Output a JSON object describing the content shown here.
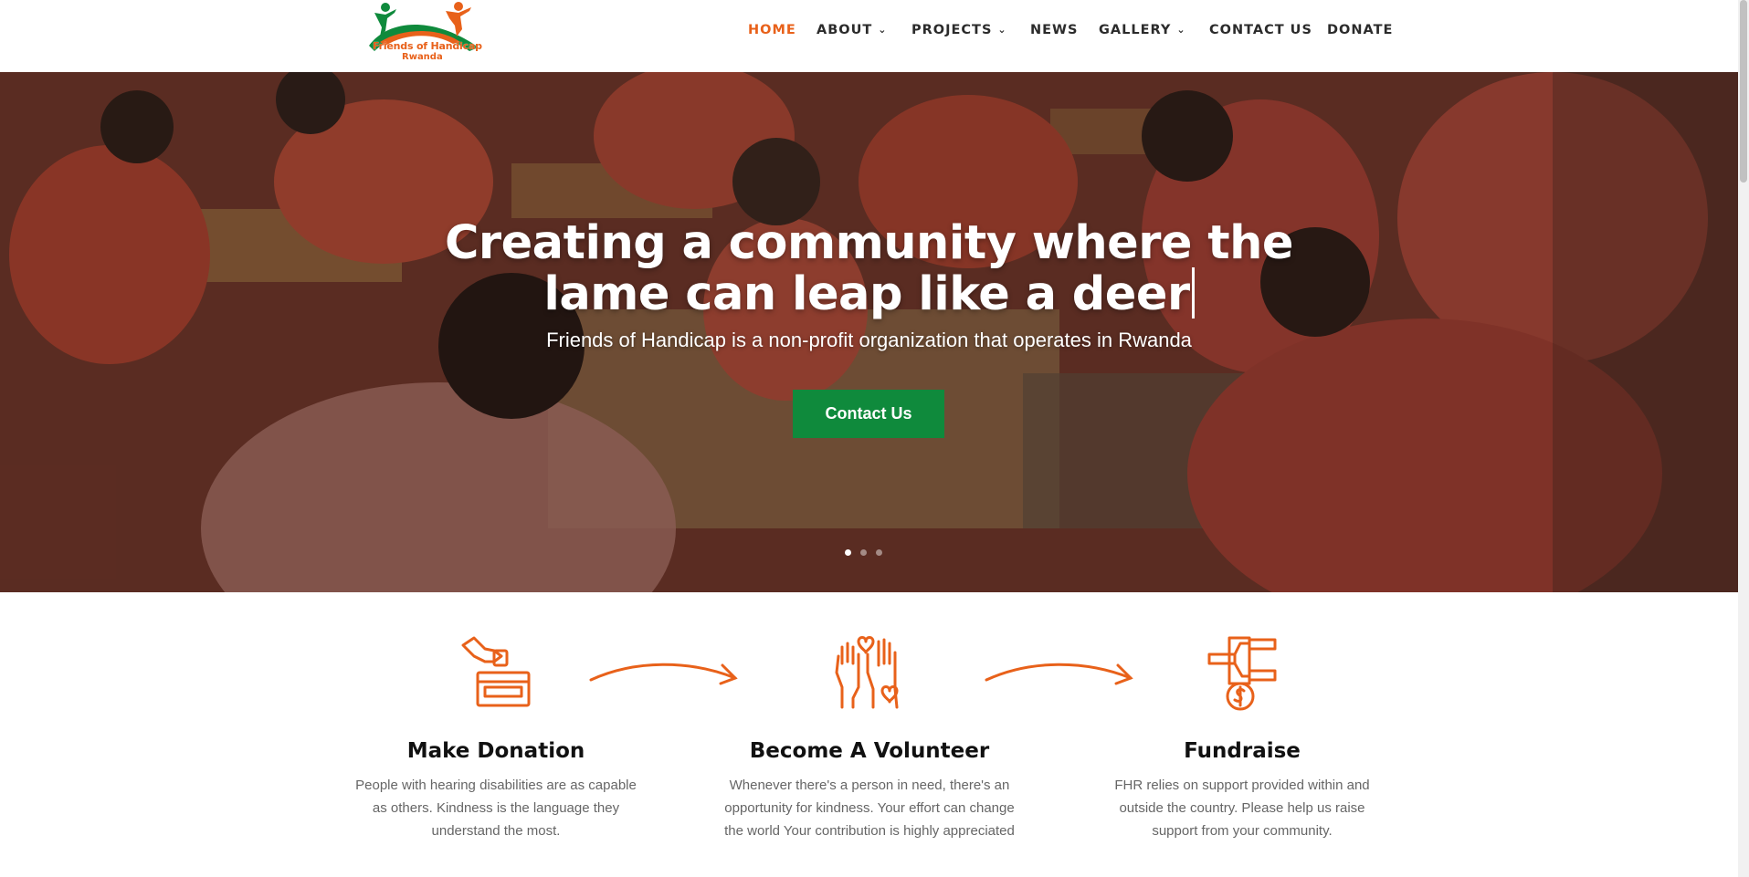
{
  "brand": {
    "name_line1": "Friends of Handicap",
    "name_line2": "Rwanda",
    "colors": {
      "orange": "#e8611a",
      "green": "#0f8a3c"
    }
  },
  "nav": {
    "items": [
      {
        "label": "HOME",
        "active": true,
        "has_dropdown": false
      },
      {
        "label": "ABOUT",
        "active": false,
        "has_dropdown": true
      },
      {
        "label": "PROJECTS",
        "active": false,
        "has_dropdown": true
      },
      {
        "label": "NEWS",
        "active": false,
        "has_dropdown": false
      },
      {
        "label": "GALLERY",
        "active": false,
        "has_dropdown": true
      },
      {
        "label": "CONTACT US",
        "active": false,
        "has_dropdown": false
      },
      {
        "label": "DONATE",
        "active": false,
        "has_dropdown": false
      }
    ],
    "dropdown_icon": "chevron-down-icon"
  },
  "hero": {
    "title_line1": "Creating a community where the",
    "title_line2": "lame can leap like a deer",
    "subtitle": "Friends of Handicap is a non-profit organization that operates in Rwanda",
    "button_label": "Contact Us",
    "slides": [
      {
        "active": true
      },
      {
        "active": false
      },
      {
        "active": false
      }
    ]
  },
  "features": [
    {
      "icon": "donation-box-icon",
      "title": "Make Donation",
      "text": "People with hearing disabilities are as capable as others. Kindness is the language they understand the most."
    },
    {
      "icon": "volunteer-hands-icon",
      "title": "Become A Volunteer",
      "text": "Whenever there's a person in need, there's an opportunity for kindness. Your effort can change the world Your contribution is highly appreciated"
    },
    {
      "icon": "fundraise-icon",
      "title": "Fundraise",
      "text": "FHR relies on support provided within and outside the country. Please help us raise support from your community."
    }
  ]
}
